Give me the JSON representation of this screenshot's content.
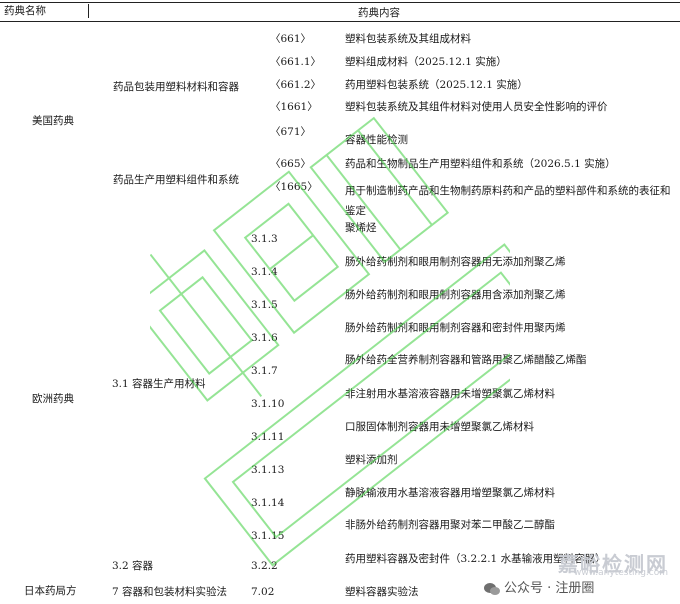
{
  "header": {
    "col1": "药典名称",
    "col2": "药典内容"
  },
  "usp": {
    "name": "美国药典",
    "groups": [
      {
        "title": "药品包装用塑料材料和容器",
        "items": [
          {
            "code": "〈661〉",
            "text": "塑料包装系统及其组成材料"
          },
          {
            "code": "〈661.1〉",
            "text": "塑料组成材料（2025.12.1 实施）"
          },
          {
            "code": "〈661.2〉",
            "text": "药用塑料包装系统（2025.12.1 实施）"
          },
          {
            "code": "〈1661〉",
            "text": "塑料包装系统及其组件材料对使用人员安全性影响的评价"
          },
          {
            "code": "〈671〉",
            "text": "容器性能检测"
          }
        ]
      },
      {
        "title": "药品生产用塑料组件和系统",
        "items": [
          {
            "code": "〈665〉",
            "text": "药品和生物制品生产用塑料组件和系统（2026.5.1 实施）"
          },
          {
            "code": "〈1665〉",
            "text": "用于制造制药产品和生物制药原料药和产品的塑料部件和系统的表征和鉴定"
          }
        ]
      }
    ]
  },
  "ep": {
    "name": "欧洲药典",
    "groups": [
      {
        "title": "3.1 容器生产用材料",
        "items": [
          {
            "code": "3.1.3",
            "text": "聚烯烃"
          },
          {
            "code": "3.1.4",
            "text": "肠外给药制剂和眼用制剂容器用无添加剂聚乙烯"
          },
          {
            "code": "3.1.5",
            "text": "肠外给药制剂和眼用制剂容器用含添加剂聚乙烯"
          },
          {
            "code": "3.1.6",
            "text": "肠外给药制剂和眼用制剂容器和密封件用聚丙烯"
          },
          {
            "code": "3.1.7",
            "text": "肠外给药全营养制剂容器和管路用聚乙烯醋酸乙烯酯"
          },
          {
            "code": "3.1.10",
            "text": "非注射用水基溶液容器用未增塑聚氯乙烯材料"
          },
          {
            "code": "3.1.11",
            "text": "口服固体制剂容器用未增塑聚氯乙烯材料"
          },
          {
            "code": "3.1.13",
            "text": "塑料添加剂"
          },
          {
            "code": "3.1.14",
            "text": "静脉输液用水基溶液容器用增塑聚氯乙烯材料"
          },
          {
            "code": "3.1.15",
            "text": "非肠外给药制剂容器用聚对苯二甲酸乙二醇酯"
          }
        ]
      },
      {
        "title": "3.2 容器",
        "items": [
          {
            "code": "3.2.2",
            "text": "药用塑料容器及密封件（3.2.2.1 水基输液用塑料容器）"
          }
        ]
      }
    ]
  },
  "jp": {
    "name": "日本药局方",
    "groups": [
      {
        "title": "7 容器和包装材料实验法",
        "items": [
          {
            "code": "7.02",
            "text": "塑料容器实验法"
          }
        ]
      }
    ]
  },
  "overlay": {
    "brand": "嘉峪检测网",
    "brand_url": "www.anytesting.com",
    "account": "公众号 · 注册圈"
  },
  "colors": {
    "watermark": "#3fcf3f",
    "text": "#1a1a1a",
    "line": "#222222"
  }
}
